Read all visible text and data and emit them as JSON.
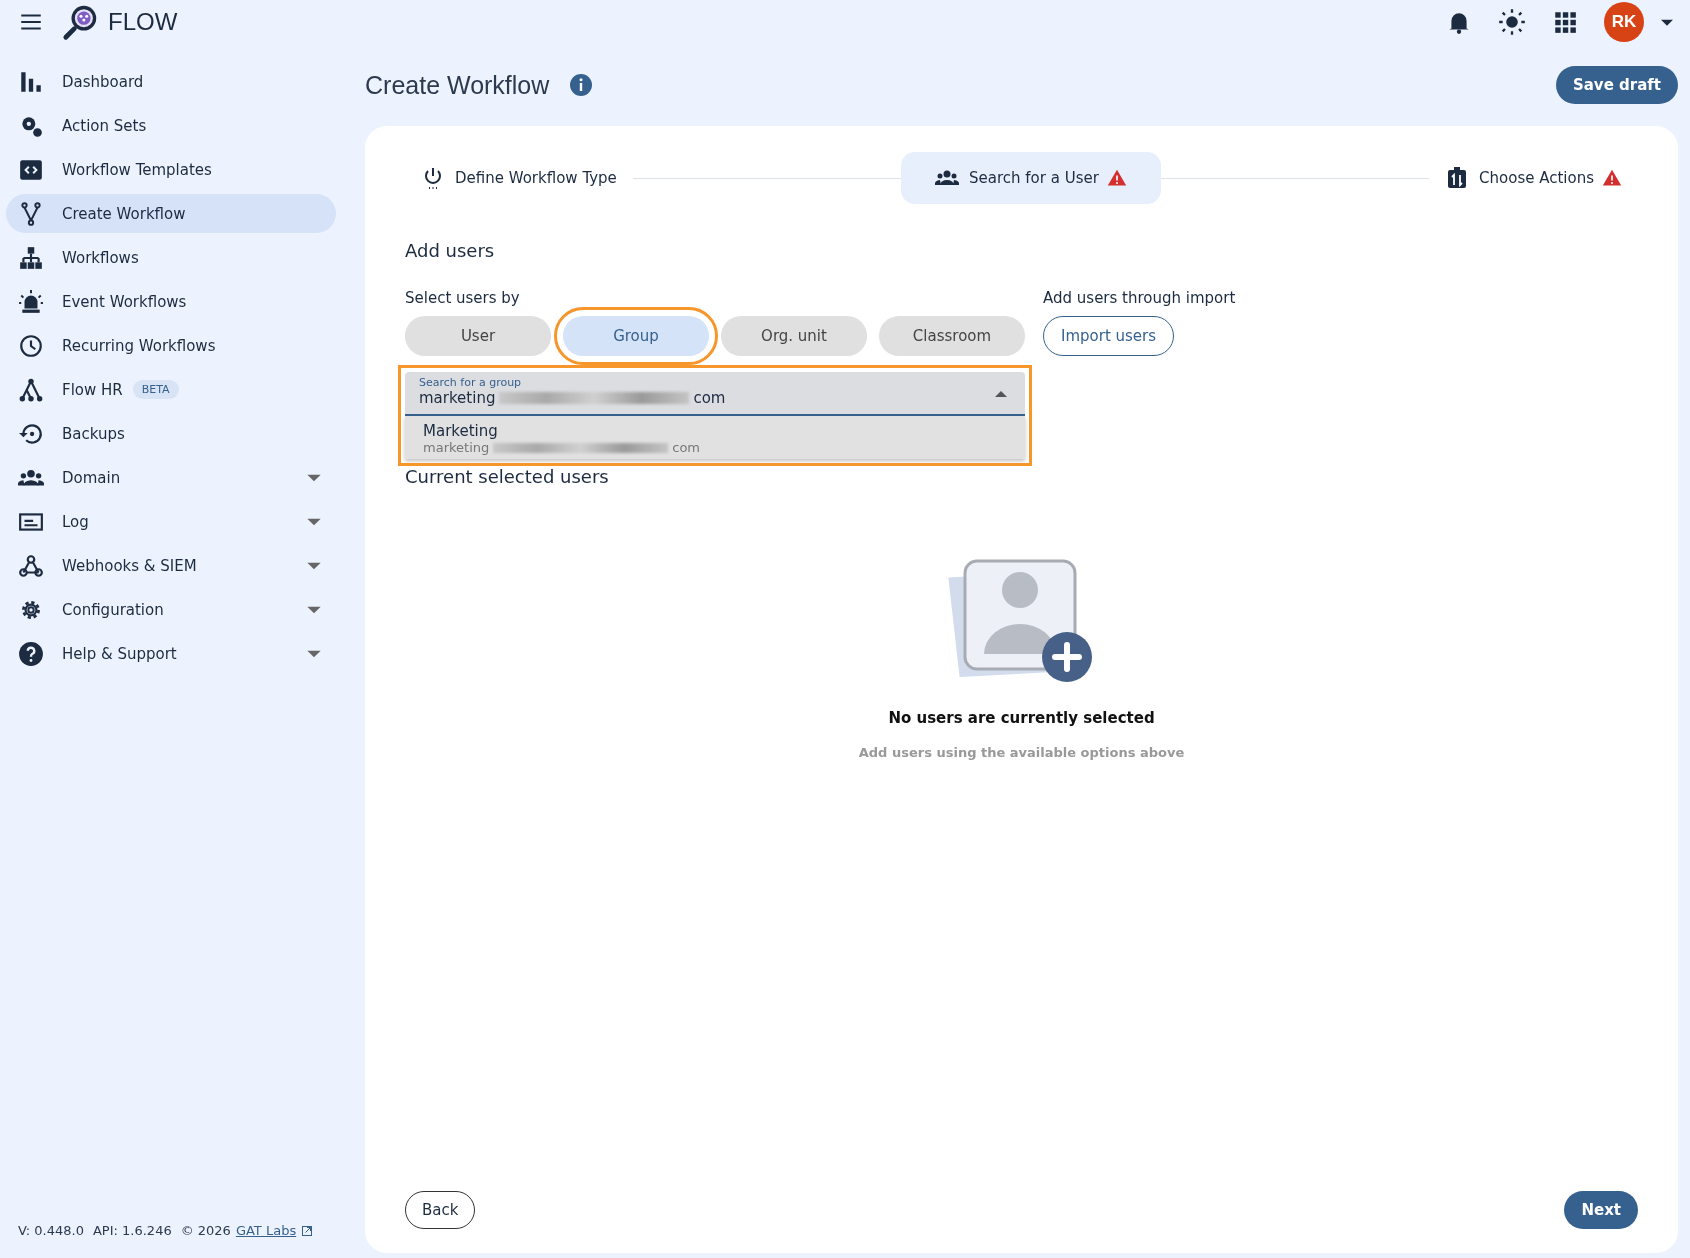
{
  "app": {
    "name": "FLOW",
    "avatar": "RK"
  },
  "sidebar": {
    "items": [
      {
        "label": "Dashboard",
        "selected": false,
        "expandable": false
      },
      {
        "label": "Action Sets",
        "selected": false,
        "expandable": false
      },
      {
        "label": "Workflow Templates",
        "selected": false,
        "expandable": false
      },
      {
        "label": "Create Workflow",
        "selected": true,
        "expandable": false
      },
      {
        "label": "Workflows",
        "selected": false,
        "expandable": false
      },
      {
        "label": "Event Workflows",
        "selected": false,
        "expandable": false
      },
      {
        "label": "Recurring Workflows",
        "selected": false,
        "expandable": false
      },
      {
        "label": "Flow HR",
        "badge": "BETA",
        "selected": false,
        "expandable": false
      },
      {
        "label": "Backups",
        "selected": false,
        "expandable": false
      },
      {
        "label": "Domain",
        "selected": false,
        "expandable": true
      },
      {
        "label": "Log",
        "selected": false,
        "expandable": true
      },
      {
        "label": "Webhooks & SIEM",
        "selected": false,
        "expandable": true
      },
      {
        "label": "Configuration",
        "selected": false,
        "expandable": true
      },
      {
        "label": "Help & Support",
        "selected": false,
        "expandable": true
      }
    ],
    "footer": {
      "version": "V: 0.448.0",
      "api": "API: 1.6.246",
      "copyright": "© 2026",
      "link": "GAT Labs"
    }
  },
  "page": {
    "title": "Create Workflow",
    "save_button": "Save draft"
  },
  "stepper": [
    {
      "label": "Define Workflow Type",
      "selected": false,
      "warning": false
    },
    {
      "label": "Search for a User",
      "selected": true,
      "warning": true
    },
    {
      "label": "Choose Actions",
      "selected": false,
      "warning": true
    }
  ],
  "add_users": {
    "heading": "Add users",
    "select_label": "Select users by",
    "options": [
      {
        "label": "User",
        "selected": false,
        "highlighted": false
      },
      {
        "label": "Group",
        "selected": true,
        "highlighted": true
      },
      {
        "label": "Org. unit",
        "selected": false,
        "highlighted": false
      },
      {
        "label": "Classroom",
        "selected": false,
        "highlighted": false
      }
    ],
    "import_label": "Add users through import",
    "import_button": "Import users"
  },
  "search": {
    "label": "Search for a group",
    "value": "marketing",
    "value_end": "com",
    "expanded": true,
    "highlighted": true,
    "results": [
      {
        "name": "Marketing",
        "email": "marketing",
        "email_end": "com"
      }
    ]
  },
  "selected_users": {
    "heading": "Current selected users",
    "empty_title": "No users are currently selected",
    "empty_hint": "Add users using the available options above"
  },
  "footer_buttons": {
    "back": "Back",
    "next": "Next"
  }
}
